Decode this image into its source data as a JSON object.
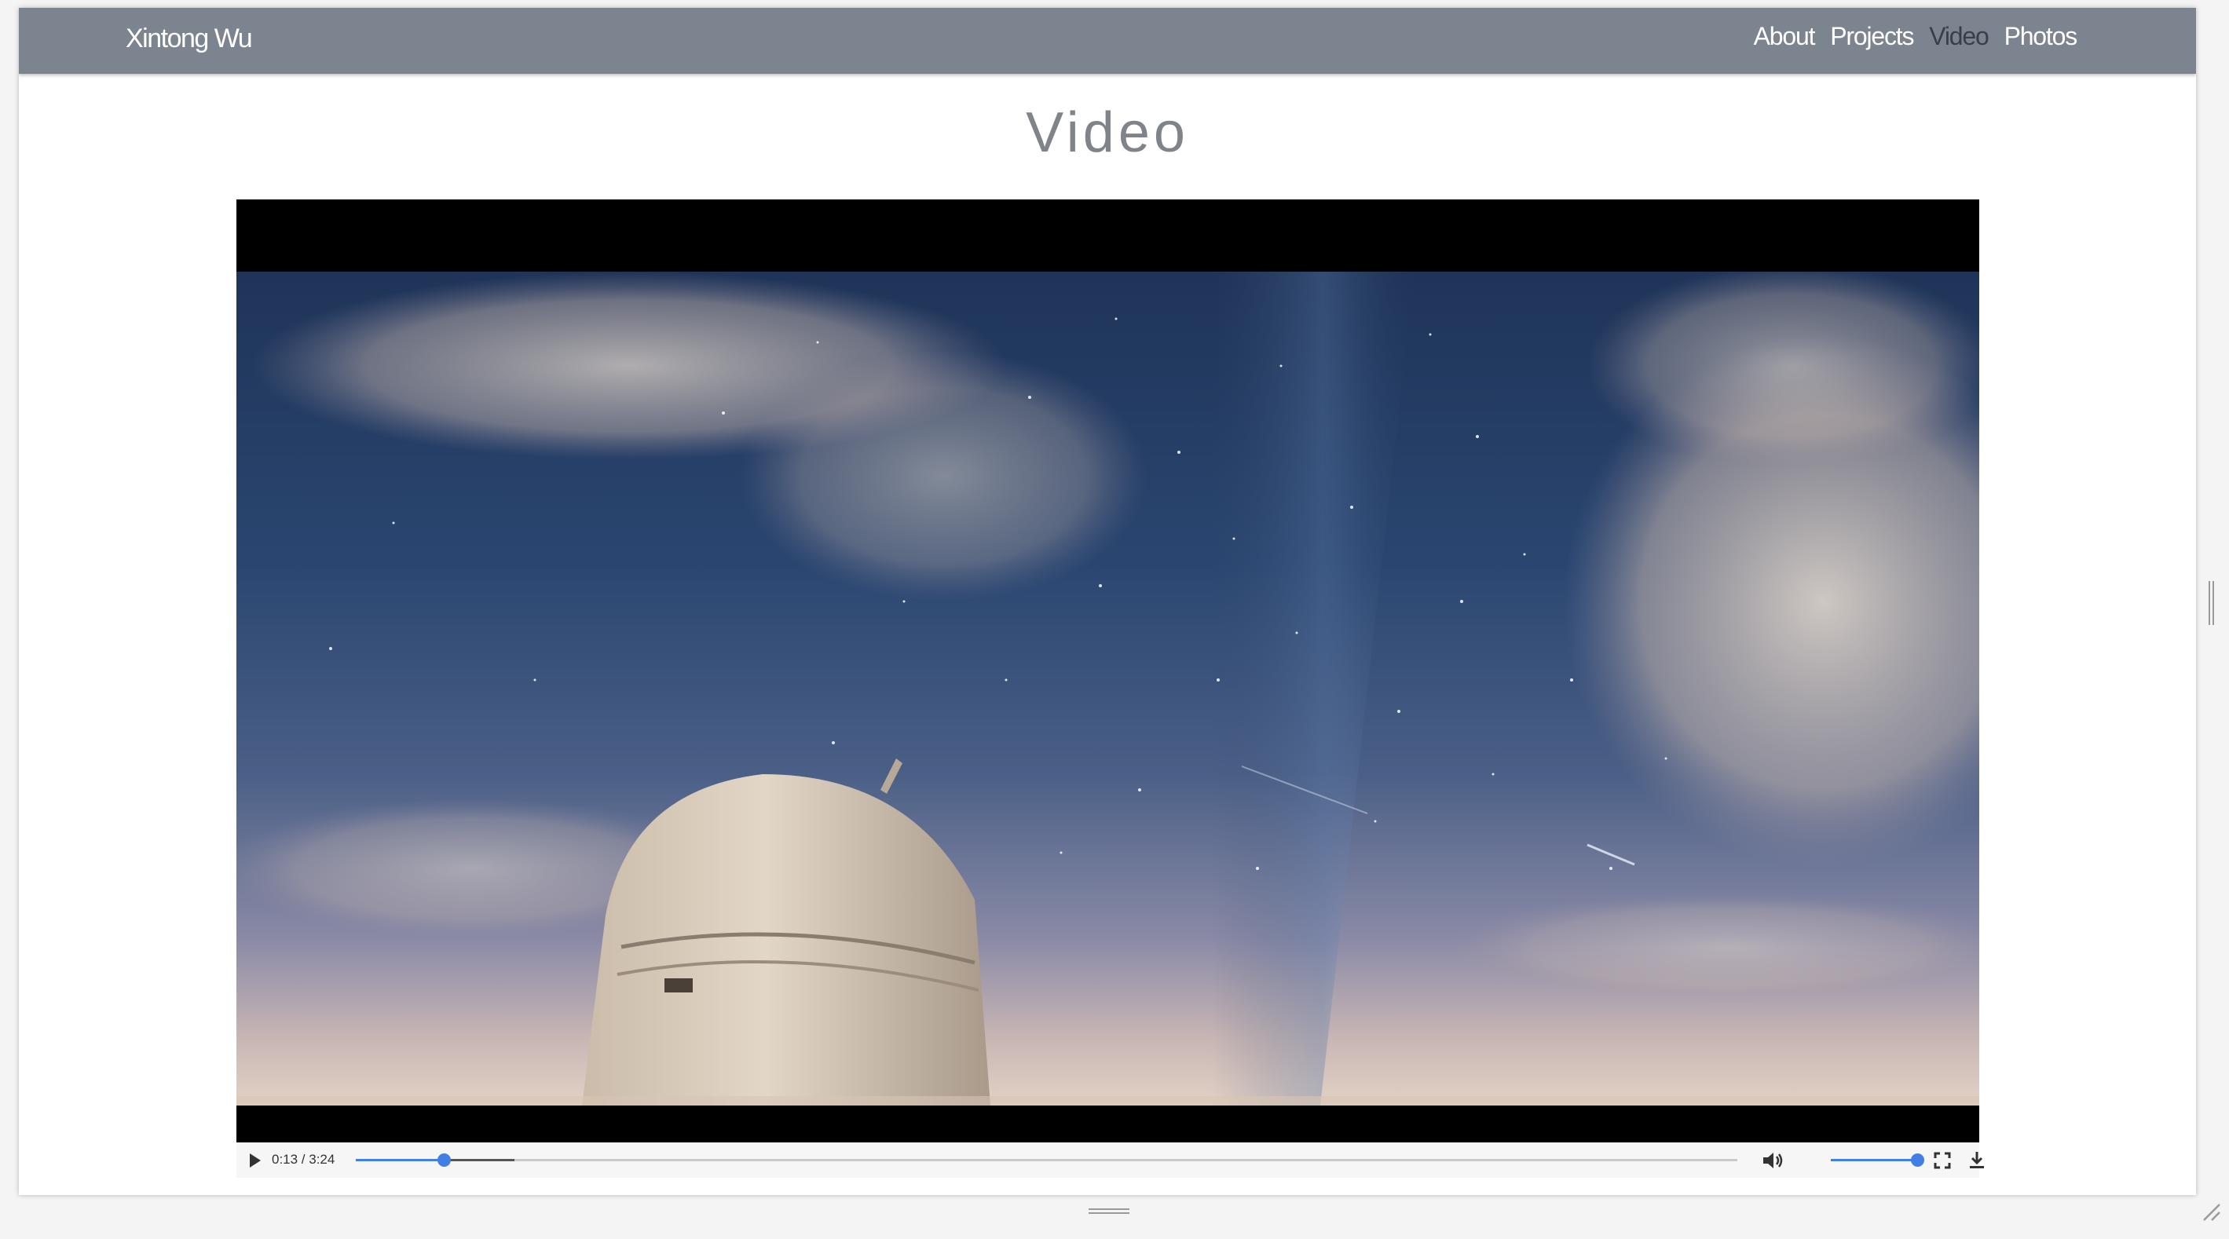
{
  "navbar": {
    "brand": "Xintong Wu",
    "links": [
      {
        "label": "About",
        "active": false
      },
      {
        "label": "Projects",
        "active": false
      },
      {
        "label": "Video",
        "active": true
      },
      {
        "label": "Photos",
        "active": false
      }
    ]
  },
  "page": {
    "title": "Video"
  },
  "video_player": {
    "time_display": "0:13 / 3:24",
    "progress_fraction": 0.0637,
    "buffered_fraction": 0.115,
    "volume_fraction": 1.0,
    "state": "paused",
    "icons": {
      "play": "play-icon",
      "volume": "volume-icon",
      "fullscreen": "fullscreen-icon",
      "download": "download-icon"
    }
  },
  "colors": {
    "navbar_bg": "#7c848f",
    "nav_active": "#3a3f47",
    "accent": "#3f7fe6",
    "title_gray": "#7f848a"
  }
}
